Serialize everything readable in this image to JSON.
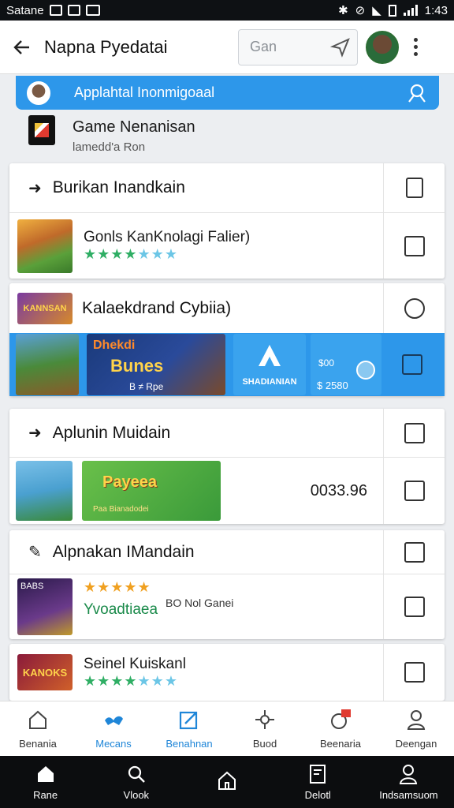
{
  "status_bar": {
    "carrier": "Satane",
    "time": "1:43"
  },
  "app_bar": {
    "title": "Napna Pyedatai",
    "search_placeholder": "Gan"
  },
  "banner": {
    "text": "Applahtal Inonmigoaal"
  },
  "game_new": {
    "title": "Game Nenanisan",
    "subtitle": "lamedd'a Ron"
  },
  "sections": [
    {
      "heading": "Burikan Inandkain",
      "item_title": "Gonls KanKnolagi Falier)",
      "rating_filled": 4,
      "rating_total": 7
    },
    {
      "heading": "Kalaekdrand Cybiia)",
      "item_logo": "KANNSAN",
      "promo_title": "Dhekdi",
      "promo_name": "Bunes",
      "promo_sub": "B ≠ Rpe",
      "promo_center": "SHADIANIAN",
      "promo_stats": "$ 2580",
      "promo_stat_top": "$00"
    },
    {
      "heading": "Aplunin Muidain",
      "item_art": "Payeea",
      "item_art_sub": "Paa Bianadodei",
      "value": "0033.96"
    },
    {
      "heading": "Alpnakan IMandain",
      "item_name": "Yvoadtiaea",
      "item_meta": "BO Nol Ganei",
      "game_label": "BABS"
    },
    {
      "heading": "Seinel Kuiskanl",
      "item_logo": "KANOKS",
      "rating_filled": 4,
      "rating_total": 7
    }
  ],
  "bottom_nav": [
    "Benania",
    "Mecans",
    "Benahnan",
    "Buod",
    "Beenaria",
    "Deengan"
  ],
  "system_nav": [
    "Rane",
    "Vlook",
    "",
    "Delotl",
    "Indsamsuom"
  ],
  "colors": {
    "accent": "#2d97ea",
    "star": "#2fae64",
    "star_alt": "#6cc6e6"
  }
}
